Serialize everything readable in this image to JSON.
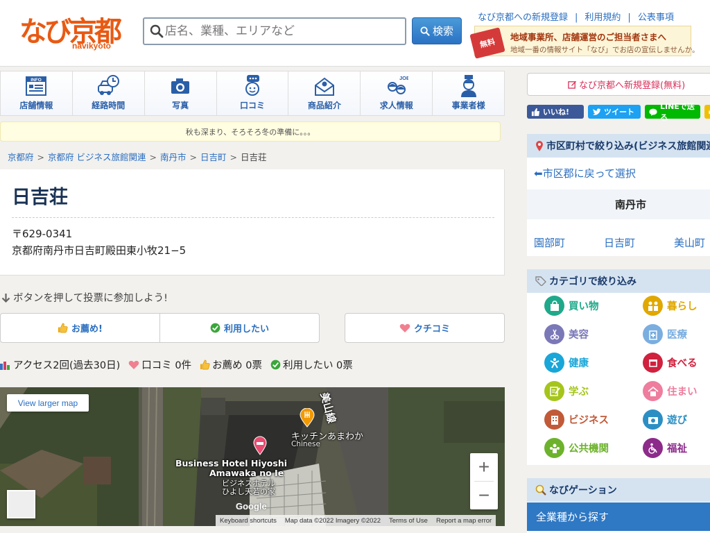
{
  "header": {
    "logo_text": "なび京都",
    "logo_sub": "navikyoto",
    "search_placeholder": "店名、業種、エリアなど",
    "search_button": "検索",
    "top_links": [
      "なび京都への新規登録",
      "利用規約",
      "公表事項"
    ],
    "banner": {
      "badge": "無料",
      "line1": "地域事業所、店舗運営のご担当者さまへ",
      "line2": "地域一番の情報サイト「なび」でお店の宣伝しませんか。"
    }
  },
  "nav": [
    {
      "label": "店舗情報",
      "icon": "info-icon"
    },
    {
      "label": "経路時間",
      "icon": "car-clock-icon"
    },
    {
      "label": "写真",
      "icon": "camera-icon"
    },
    {
      "label": "口コミ",
      "icon": "chat-person-icon"
    },
    {
      "label": "商品紹介",
      "icon": "gift-icon"
    },
    {
      "label": "求人情報",
      "icon": "job-icon"
    },
    {
      "label": "事業者様",
      "icon": "business-person-icon"
    }
  ],
  "notice": "秋も深まり、そろそろ冬の準備に。。。",
  "breadcrumb": [
    "京都府",
    "京都府 ビジネス旅館関連",
    "南丹市",
    "日吉町",
    "日吉荘"
  ],
  "shop": {
    "name": "日吉荘",
    "zip": "〒629-0341",
    "address": "京都府南丹市日吉町殿田東小牧21−5"
  },
  "vote": {
    "prompt": "ボタンを押して投票に参加しよう!",
    "recommend": "お薦め!",
    "want": "利用したい",
    "review": "クチコミ"
  },
  "stats": {
    "access": "アクセス2回(過去30日)",
    "reviews": "口コミ 0件",
    "recommend": "お薦め 0票",
    "want": "利用したい 0票"
  },
  "map": {
    "larger": "View larger map",
    "road_label": "美山線",
    "place1_name": "キッチンあまわか",
    "place1_type": "Chinese",
    "place2_en1": "Business Hotel Hiyoshi",
    "place2_en2": "Amawaka no Ie",
    "place2_ja1": "ビジネスホテル",
    "place2_ja2": "ひよし天若の家",
    "google": "Google",
    "footer": [
      "Keyboard shortcuts",
      "Map data ©2022 Imagery ©2022",
      "Terms of Use",
      "Report a map error"
    ]
  },
  "sidebar": {
    "register": "なび京都へ新規登録(無料)",
    "share": {
      "fb": "いいね!",
      "tw": "ツイート",
      "line": "LINEで送る"
    },
    "area_title": "市区町村で絞り込み(ビジネス旅館関連)",
    "back_link": "⬅市区郡に戻って選択",
    "city": "南丹市",
    "towns": [
      "園部町",
      "日吉町",
      "美山町"
    ],
    "category_title": "カテゴリで絞り込み",
    "categories": [
      {
        "label": "買い物",
        "color": "#1fa98a",
        "icon": "shopping-bag-icon"
      },
      {
        "label": "暮らし",
        "color": "#e0a800",
        "icon": "family-icon"
      },
      {
        "label": "美容",
        "color": "#7b78b8",
        "icon": "beauty-icon"
      },
      {
        "label": "医療",
        "color": "#7aaee0",
        "icon": "medical-icon"
      },
      {
        "label": "健康",
        "color": "#19a6d8",
        "icon": "health-icon"
      },
      {
        "label": "食べる",
        "color": "#d0213e",
        "icon": "food-icon"
      },
      {
        "label": "学ぶ",
        "color": "#a5c51b",
        "icon": "study-icon"
      },
      {
        "label": "住まい",
        "color": "#ee7d9e",
        "icon": "house-icon"
      },
      {
        "label": "ビジネス",
        "color": "#c15a38",
        "icon": "building-icon"
      },
      {
        "label": "遊び",
        "color": "#2b8fc4",
        "icon": "camera-icon"
      },
      {
        "label": "公共機関",
        "color": "#6db22c",
        "icon": "public-icon"
      },
      {
        "label": "福祉",
        "color": "#8c2b8a",
        "icon": "wheelchair-icon"
      }
    ],
    "navigation_title": "なびゲーション",
    "all_industries": "全業種から探す"
  }
}
